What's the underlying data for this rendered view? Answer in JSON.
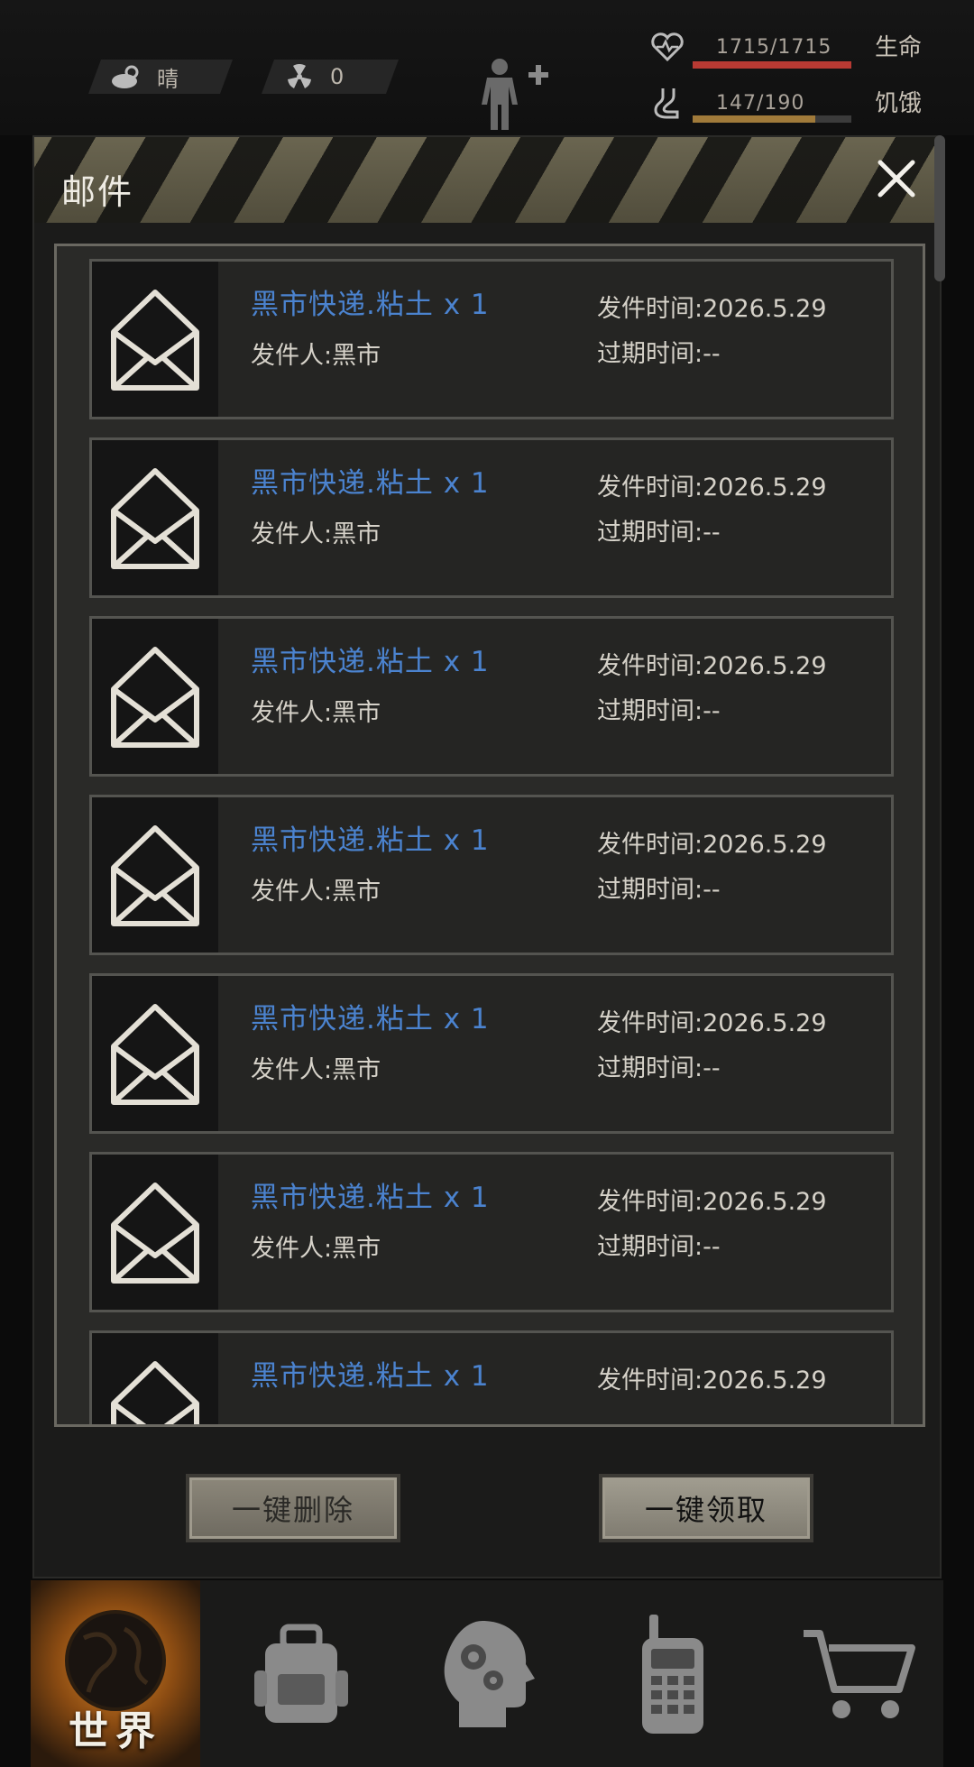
{
  "status": {
    "weather": {
      "icon": "cloud-sun-icon",
      "label": "晴"
    },
    "radiation": {
      "icon": "radiation-icon",
      "value": "0"
    },
    "health": {
      "icon": "heart-pulse-icon",
      "value": "1715/1715",
      "label": "生命",
      "fraction": 1.0,
      "color": "#b83a33"
    },
    "hunger": {
      "icon": "stomach-icon",
      "value": "147/190",
      "label": "饥饿",
      "fraction": 0.774,
      "color": "#a07a3a"
    }
  },
  "mail_panel": {
    "title": "邮件",
    "items": [
      {
        "title": "黑市快递.粘土 x 1",
        "sender": "发件人:黑市",
        "sent": "发件时间:2026.5.29",
        "expire": "过期时间:--"
      },
      {
        "title": "黑市快递.粘土 x 1",
        "sender": "发件人:黑市",
        "sent": "发件时间:2026.5.29",
        "expire": "过期时间:--"
      },
      {
        "title": "黑市快递.粘土 x 1",
        "sender": "发件人:黑市",
        "sent": "发件时间:2026.5.29",
        "expire": "过期时间:--"
      },
      {
        "title": "黑市快递.粘土 x 1",
        "sender": "发件人:黑市",
        "sent": "发件时间:2026.5.29",
        "expire": "过期时间:--"
      },
      {
        "title": "黑市快递.粘土 x 1",
        "sender": "发件人:黑市",
        "sent": "发件时间:2026.5.29",
        "expire": "过期时间:--"
      },
      {
        "title": "黑市快递.粘土 x 1",
        "sender": "发件人:黑市",
        "sent": "发件时间:2026.5.29",
        "expire": "过期时间:--"
      },
      {
        "title": "黑市快递.粘土 x 1",
        "sender": "",
        "sent": "发件时间:2026.5.29",
        "expire": ""
      }
    ],
    "delete_all_label": "一键删除",
    "claim_all_label": "一键领取"
  },
  "nav": {
    "world_label": "世界",
    "items": [
      "globe-icon",
      "backpack-icon",
      "head-gears-icon",
      "radio-icon",
      "cart-icon"
    ]
  }
}
